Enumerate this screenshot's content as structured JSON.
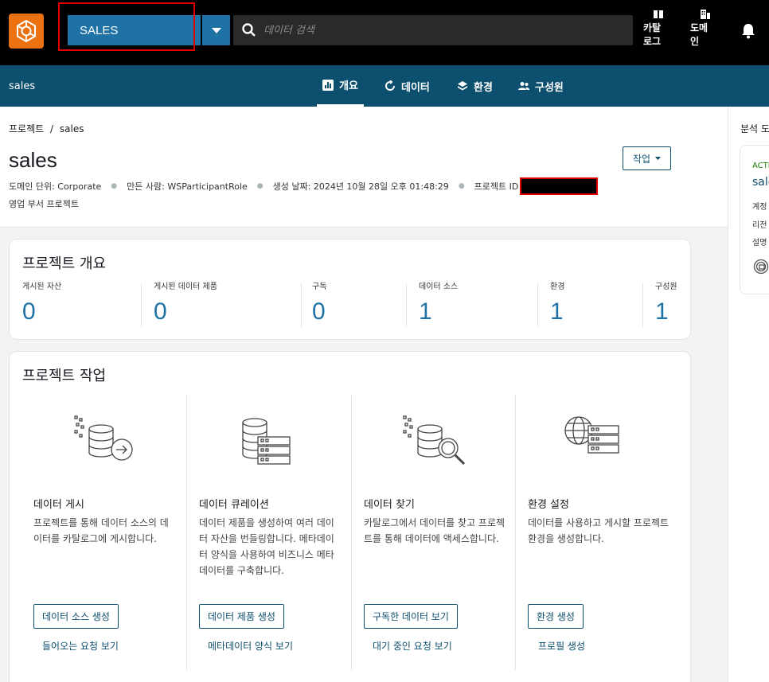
{
  "topbar": {
    "project_name": "SALES",
    "search_placeholder": "데이터 검색",
    "catalog_label": "카탈\n로그",
    "domain_label": "도메\n인"
  },
  "navbar": {
    "project": "sales",
    "tabs": [
      {
        "label": "개요",
        "icon": "chart-icon",
        "active": true
      },
      {
        "label": "데이터",
        "icon": "refresh-icon",
        "active": false
      },
      {
        "label": "환경",
        "icon": "layers-icon",
        "active": false
      },
      {
        "label": "구성원",
        "icon": "users-icon",
        "active": false
      }
    ]
  },
  "header": {
    "breadcrumb_root": "프로젝트",
    "breadcrumb_sep": "/",
    "breadcrumb_current": "sales",
    "title": "sales",
    "meta_domain_unit": "도메인 단위: Corporate",
    "meta_created_by": "만든 사람: WSParticipantRole",
    "meta_created_at": "생성 날짜: 2024년 10월 28일 오후 01:48:29",
    "meta_project_id": "프로젝트 ID",
    "description": "영업 부서 프로젝트",
    "action_label": "작업"
  },
  "overview": {
    "title": "프로젝트 개요",
    "stats": [
      {
        "label": "게시된 자산",
        "value": "0"
      },
      {
        "label": "게시된 데이터 제품",
        "value": "0"
      },
      {
        "label": "구독",
        "value": "0"
      },
      {
        "label": "데이터 소스",
        "value": "1"
      },
      {
        "label": "환경",
        "value": "1"
      },
      {
        "label": "구성원",
        "value": "1"
      }
    ]
  },
  "tasks": {
    "title": "프로젝트 작업",
    "items": [
      {
        "title": "데이터 게시",
        "desc": "프로젝트를 통해 데이터 소스의 데이터를 카탈로그에 게시합니다.",
        "button": "데이터 소스 생성",
        "link": "들어오는 요청 보기"
      },
      {
        "title": "데이터 큐레이션",
        "desc": "데이터 제품을 생성하여 여러 데이터 자산을 번들링합니다. 메타데이터 양식을 사용하여 비즈니스 메타데이터를 구축합니다.",
        "button": "데이터 제품 생성",
        "link": "메타데이터 양식 보기"
      },
      {
        "title": "데이터 찾기",
        "desc": "카탈로그에서 데이터를 찾고 프로젝트를 통해 데이터에 액세스합니다.",
        "button": "구독한 데이터 보기",
        "link": "대기 중인 요청 보기"
      },
      {
        "title": "환경 설정",
        "desc": "데이터를 사용하고 게시할 프로젝트 환경을 생성합니다.",
        "button": "환경 생성",
        "link": "프로필 생성"
      }
    ]
  },
  "side": {
    "title": "분석 도",
    "status": "ACTI",
    "name": "sale",
    "row1": "계정",
    "row2": "리전",
    "row3": "설명"
  },
  "colors": {
    "accent": "#1f72a6",
    "nav": "#0d4f6e",
    "logo": "#ec7211",
    "active_status": "#1d8102"
  }
}
